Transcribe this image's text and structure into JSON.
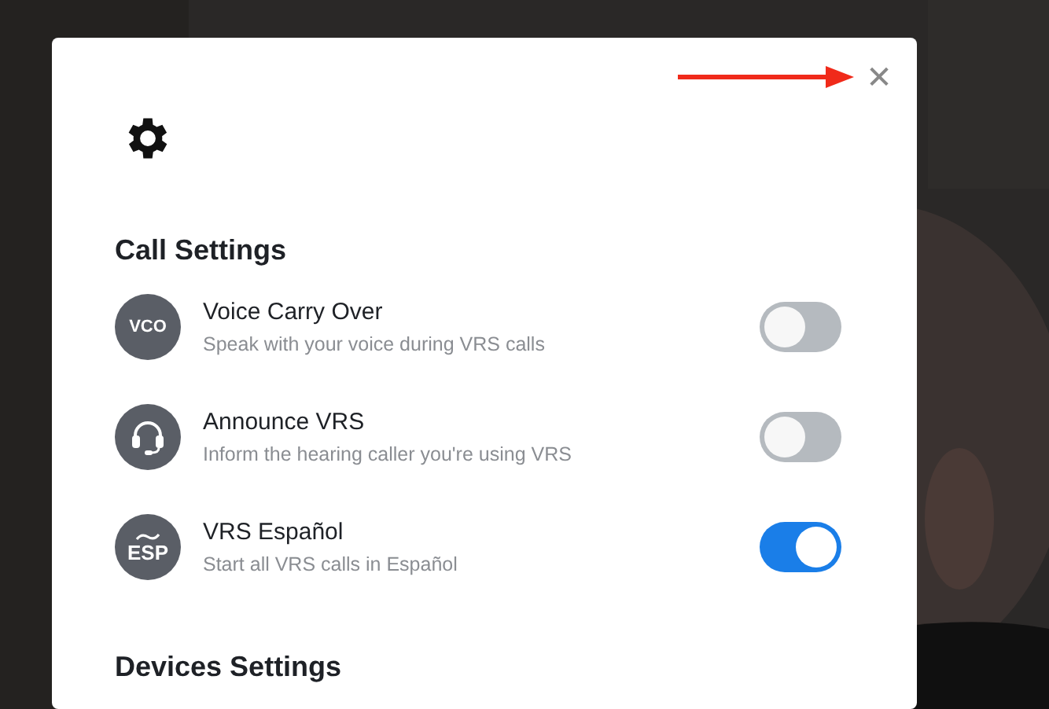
{
  "dialog": {
    "close": "✕",
    "sections": [
      {
        "title": "Call Settings",
        "items": [
          {
            "title": "Voice Carry Over",
            "subtitle": "Speak with your voice during VRS calls",
            "icon": {
              "kind": "text",
              "text": "VCO"
            },
            "on": false
          },
          {
            "title": "Announce VRS",
            "subtitle": "Inform the hearing caller you're using VRS",
            "icon": {
              "kind": "headset"
            },
            "on": false
          },
          {
            "title": "VRS Español",
            "subtitle": "Start all VRS calls in Español",
            "icon": {
              "kind": "tilde-text",
              "text": "ESP"
            },
            "on": true
          }
        ]
      },
      {
        "title": "Devices Settings"
      }
    ]
  }
}
